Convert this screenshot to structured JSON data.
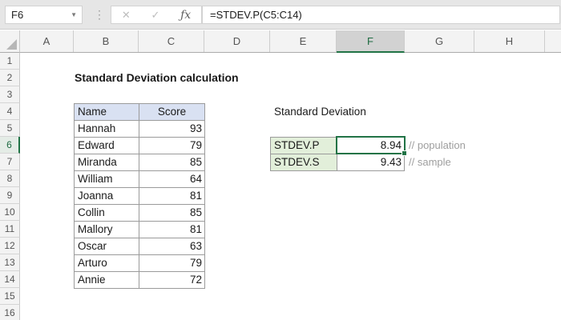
{
  "formula_bar": {
    "cell_reference": "F6",
    "formula": "=STDEV.P(C5:C14)",
    "cancel_glyph": "✕",
    "enter_glyph": "✓",
    "fx_glyph": "ƒx",
    "name_caret_glyph": "▼",
    "dots_glyph": "⋮"
  },
  "grid": {
    "column_headers": [
      "A",
      "B",
      "C",
      "D",
      "E",
      "F",
      "G",
      "H"
    ],
    "row_headers": [
      "1",
      "2",
      "3",
      "4",
      "5",
      "6",
      "7",
      "8",
      "9",
      "10",
      "11",
      "12",
      "13",
      "14",
      "15",
      "16"
    ],
    "selected_cell": "F6",
    "selected_column": "F",
    "selected_row": "6"
  },
  "sheet": {
    "title": "Standard Deviation calculation",
    "table": {
      "name_header": "Name",
      "score_header": "Score",
      "rows": [
        {
          "name": "Hannah",
          "score": "93"
        },
        {
          "name": "Edward",
          "score": "79"
        },
        {
          "name": "Miranda",
          "score": "85"
        },
        {
          "name": "William",
          "score": "64"
        },
        {
          "name": "Joanna",
          "score": "81"
        },
        {
          "name": "Collin",
          "score": "85"
        },
        {
          "name": "Mallory",
          "score": "81"
        },
        {
          "name": "Oscar",
          "score": "63"
        },
        {
          "name": "Arturo",
          "score": "79"
        },
        {
          "name": "Annie",
          "score": "72"
        }
      ]
    },
    "results": {
      "section_label": "Standard Deviation",
      "items": [
        {
          "function": "STDEV.P",
          "value": "8.94",
          "comment": "// population"
        },
        {
          "function": "STDEV.S",
          "value": "9.43",
          "comment": "// sample"
        }
      ]
    }
  },
  "colors": {
    "selection_green": "#217346",
    "table_header_fill": "#D9E1F2",
    "function_cell_fill": "#E2EFDA",
    "comment_text": "#9E9E9E",
    "chrome_background": "#E6E6E6"
  }
}
